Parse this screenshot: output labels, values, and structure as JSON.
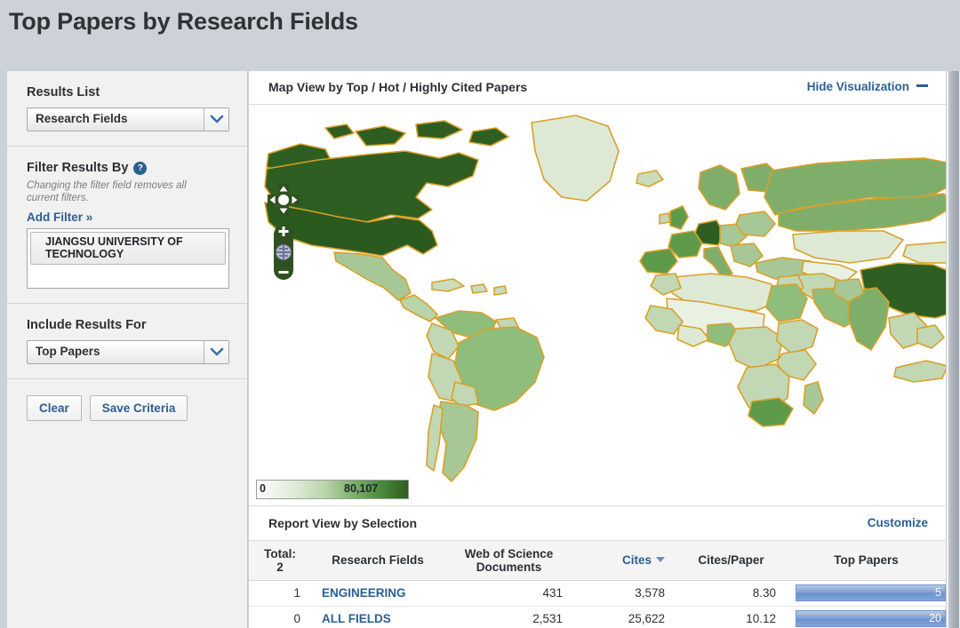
{
  "page": {
    "title": "Top Papers by Research Fields"
  },
  "sidebar": {
    "results_list": {
      "label": "Results List",
      "selected": "Research Fields",
      "options": [
        "Research Fields"
      ]
    },
    "filter": {
      "label": "Filter Results By",
      "help_icon": "question-mark-icon",
      "note": "Changing the filter field removes all current filters.",
      "add_filter_label": "Add Filter »",
      "items": [
        "JIANGSU UNIVERSITY OF TECHNOLOGY"
      ]
    },
    "include": {
      "label": "Include Results For",
      "selected": "Top Papers",
      "options": [
        "Top Papers"
      ]
    },
    "buttons": {
      "clear": "Clear",
      "save": "Save Criteria"
    }
  },
  "map_panel": {
    "title": "Map View by Top / Hot / Highly Cited Papers",
    "toggle_label": "Hide Visualization",
    "legend": {
      "min": "0",
      "max": "80,107"
    },
    "nav": {
      "pan_icon": "pan-arrows-icon",
      "zoom_in_icon": "plus-icon",
      "zoom_out_icon": "minus-icon",
      "globe_icon": "globe-icon"
    },
    "colors": {
      "border": "#d8a12a",
      "fill_low": "#e9f1e3",
      "fill_mid": "#a7c896",
      "fill_high": "#7fae6b",
      "fill_max": "#2f5e22",
      "ocean": "#ffffff"
    }
  },
  "report": {
    "title": "Report View by Selection",
    "customize_label": "Customize",
    "total_label": "Total:",
    "total_value": "2",
    "columns": [
      {
        "key": "rank",
        "label": ""
      },
      {
        "key": "field",
        "label": "Research Fields"
      },
      {
        "key": "wos",
        "label": "Web of Science Documents"
      },
      {
        "key": "cites",
        "label": "Cites",
        "sortable": true,
        "sort": "desc"
      },
      {
        "key": "cpp",
        "label": "Cites/Paper"
      },
      {
        "key": "top",
        "label": "Top Papers"
      }
    ],
    "rows": [
      {
        "rank": "1",
        "field": "ENGINEERING",
        "wos": "431",
        "cites": "3,578",
        "cpp": "8.30",
        "top_papers_value": "5",
        "top_papers_pct": 100
      },
      {
        "rank": "0",
        "field": "ALL FIELDS",
        "wos": "2,531",
        "cites": "25,622",
        "cpp": "10.12",
        "top_papers_value": "20",
        "top_papers_pct": 100
      }
    ]
  },
  "chart_data": {
    "type": "bar",
    "title": "Top Papers",
    "categories": [
      "ENGINEERING",
      "ALL FIELDS"
    ],
    "values": [
      5,
      20
    ],
    "xlabel": "",
    "ylabel": "Top Papers",
    "orientation": "horizontal",
    "note": "Bars are clipped by the viewport right edge; labels render inside the bar right end."
  }
}
